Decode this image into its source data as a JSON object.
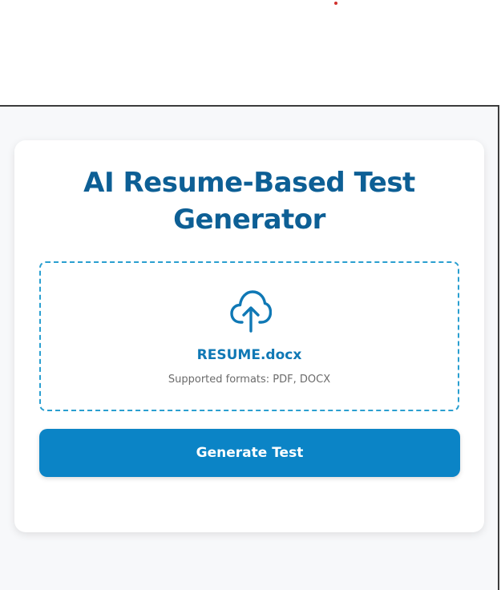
{
  "page": {
    "title": "AI Resume-Based Test Generator"
  },
  "upload": {
    "icon": "cloud-upload-icon",
    "file_name": "RESUME.docx",
    "supported_formats": "Supported formats: PDF, DOCX"
  },
  "actions": {
    "generate_label": "Generate Test"
  },
  "colors": {
    "title": "#0d5f95",
    "accent": "#0b84c6",
    "dropzone_border": "#2a9fd0",
    "file_name": "#0f78b5"
  }
}
